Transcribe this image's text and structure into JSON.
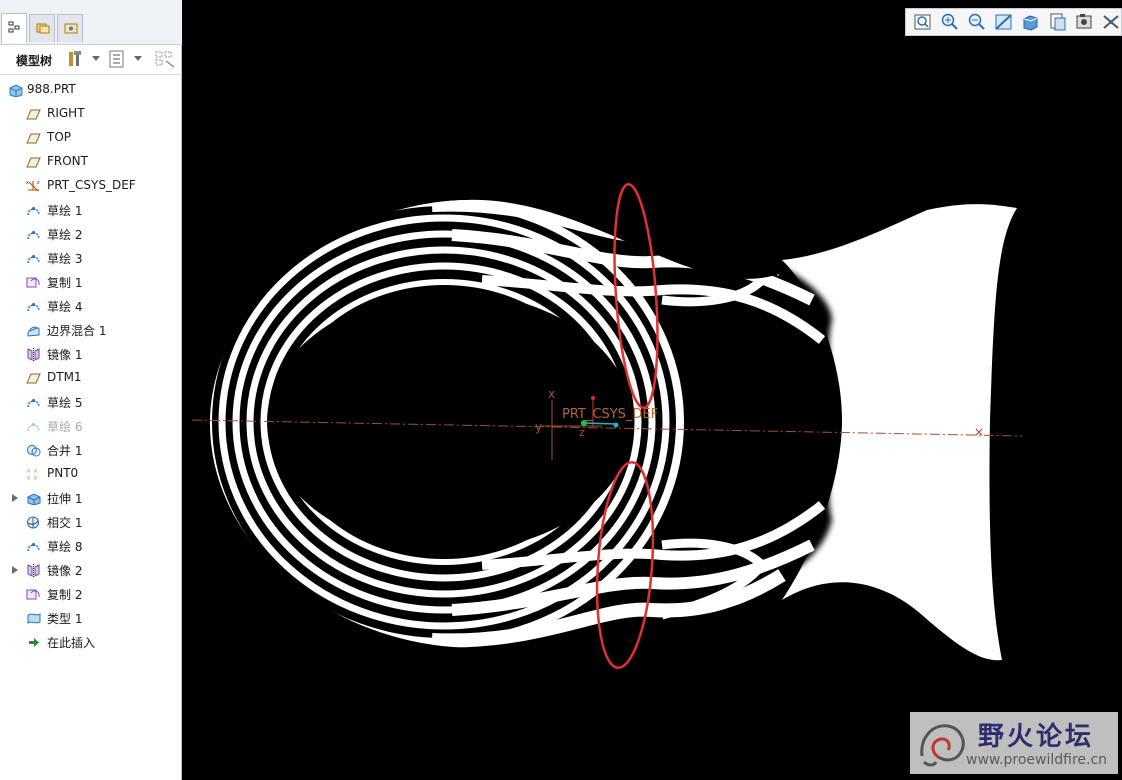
{
  "panel": {
    "title": "模型树"
  },
  "tree": [
    {
      "label": "988.PRT",
      "icon": "part-icon",
      "root": true
    },
    {
      "label": "RIGHT",
      "icon": "datum-plane-icon"
    },
    {
      "label": "TOP",
      "icon": "datum-plane-icon"
    },
    {
      "label": "FRONT",
      "icon": "datum-plane-icon"
    },
    {
      "label": "PRT_CSYS_DEF",
      "icon": "coordinate-system-icon"
    },
    {
      "label": "草绘 1",
      "icon": "sketch-icon"
    },
    {
      "label": "草绘 2",
      "icon": "sketch-icon"
    },
    {
      "label": "草绘 3",
      "icon": "sketch-icon"
    },
    {
      "label": "复制 1",
      "icon": "copy-icon"
    },
    {
      "label": "草绘 4",
      "icon": "sketch-icon"
    },
    {
      "label": "边界混合 1",
      "icon": "boundary-blend-icon"
    },
    {
      "label": "镜像 1",
      "icon": "mirror-icon"
    },
    {
      "label": "DTM1",
      "icon": "datum-plane-icon"
    },
    {
      "label": "草绘 5",
      "icon": "sketch-icon"
    },
    {
      "label": "草绘 6",
      "icon": "sketch-icon",
      "suppressed": true
    },
    {
      "label": "合并 1",
      "icon": "merge-icon"
    },
    {
      "label": "PNT0",
      "icon": "datum-point-icon"
    },
    {
      "label": "拉伸 1",
      "icon": "extrude-icon",
      "expandable": true
    },
    {
      "label": "相交 1",
      "icon": "intersect-icon"
    },
    {
      "label": "草绘 8",
      "icon": "sketch-icon"
    },
    {
      "label": "镜像 2",
      "icon": "mirror-icon",
      "expandable": true
    },
    {
      "label": "复制 2",
      "icon": "copy-icon"
    },
    {
      "label": "类型 1",
      "icon": "style-surface-icon"
    },
    {
      "label": "在此插入",
      "icon": "insert-here-arrow-icon"
    }
  ],
  "viewport": {
    "csys_label": "PRT_CSYS_DEF",
    "axis_x": "x",
    "axis_y": "y",
    "axis_z": "z",
    "colors": {
      "background": "#000000",
      "stripe": "#ffffff",
      "highlight": "#e03030",
      "axis": "#a0522d"
    }
  },
  "view_toolbar": [
    "zoom-fit-icon",
    "zoom-in-icon",
    "zoom-out-icon",
    "repaint-icon",
    "display-style-icon",
    "saved-views-icon",
    "view-manager-icon",
    "datum-display-icon"
  ],
  "watermark": {
    "name": "野火论坛",
    "url": "www.proewildfire.cn"
  }
}
